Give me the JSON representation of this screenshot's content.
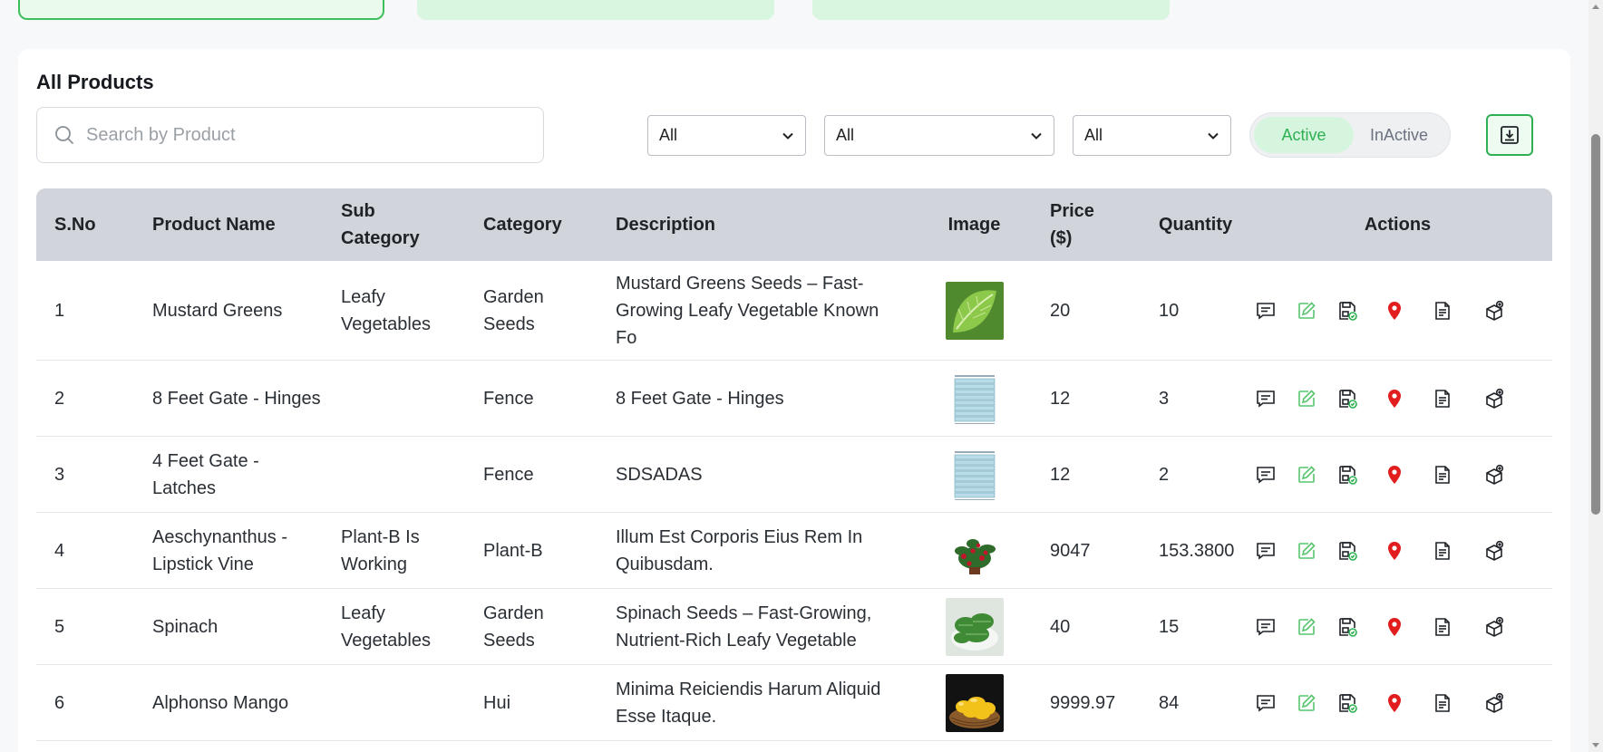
{
  "panel": {
    "title": "All Products"
  },
  "search": {
    "placeholder": "Search by Product"
  },
  "filters": [
    {
      "selected": "All"
    },
    {
      "selected": "All"
    },
    {
      "selected": "All"
    }
  ],
  "status_toggle": {
    "active_label": "Active",
    "inactive_label": "InActive",
    "selected": "Active"
  },
  "download": {
    "icon": "download-icon"
  },
  "table": {
    "headers": {
      "sno": "S.No",
      "name": "Product Name",
      "sub_line1": "Sub",
      "sub_line2": "Category",
      "category": "Category",
      "description": "Description",
      "image": "Image",
      "price_line1": "Price",
      "price_line2": "($)",
      "quantity": "Quantity",
      "actions": "Actions"
    },
    "rows": [
      {
        "sno": "1",
        "name": "Mustard Greens",
        "sub": "Leafy Vegetables",
        "category": "Garden Seeds",
        "description": "Mustard Greens Seeds – Fast-Growing Leafy Vegetable Known Fo",
        "image": "mustard-greens-thumbnail",
        "price": "20",
        "quantity": "10"
      },
      {
        "sno": "2",
        "name": "8 Feet Gate - Hinges",
        "sub": "",
        "category": "Fence",
        "description": "8 Feet Gate - Hinges",
        "image": "gate-hinges-thumbnail",
        "price": "12",
        "quantity": "3"
      },
      {
        "sno": "3",
        "name": "4 Feet Gate - Latches",
        "sub": "",
        "category": "Fence",
        "description": "SDSADAS",
        "image": "gate-latches-thumbnail",
        "price": "12",
        "quantity": "2"
      },
      {
        "sno": "4",
        "name": "Aeschynanthus - Lipstick Vine",
        "sub": "Plant-B Is Working",
        "category": "Plant-B",
        "description": "Illum Est Corporis Eius Rem In Quibusdam.",
        "image": "lipstick-vine-thumbnail",
        "price": "9047",
        "quantity": "153.3800"
      },
      {
        "sno": "5",
        "name": "Spinach",
        "sub": "Leafy Vegetables",
        "category": "Garden Seeds",
        "description": "Spinach Seeds – Fast-Growing, Nutrient-Rich Leafy Vegetable",
        "image": "spinach-thumbnail",
        "price": "40",
        "quantity": "15"
      },
      {
        "sno": "6",
        "name": "Alphonso Mango",
        "sub": "",
        "category": "Hui",
        "description": "Minima Reiciendis Harum Aliquid Esse Itaque.",
        "image": "mango-thumbnail",
        "price": "9999.97",
        "quantity": "84"
      }
    ],
    "action_icons": [
      "comment-icon",
      "edit-icon",
      "save-check-icon",
      "location-pin-icon",
      "document-icon",
      "box-add-icon"
    ]
  },
  "colors": {
    "accent_green": "#2fb052",
    "header_bg": "#d1d5db",
    "pin_red": "#e11d1d"
  }
}
